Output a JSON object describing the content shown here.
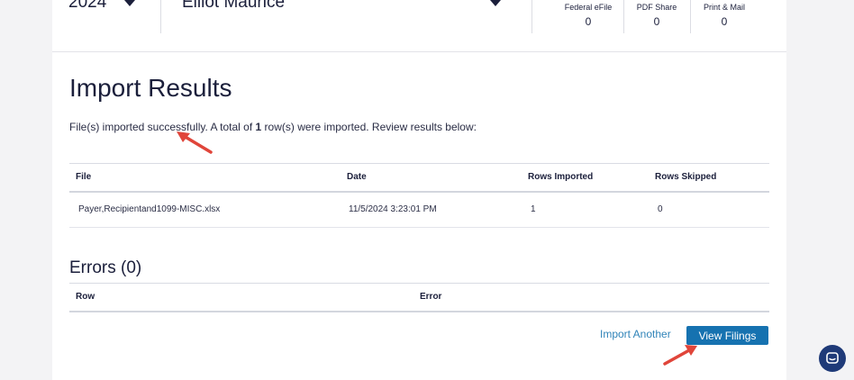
{
  "header": {
    "year": "2024",
    "payer_name": "Elliot Maurice",
    "stats": [
      {
        "label": "Federal eFile",
        "value": "0"
      },
      {
        "label": "PDF Share",
        "value": "0"
      },
      {
        "label": "Print & Mail",
        "value": "0"
      }
    ]
  },
  "import": {
    "title": "Import Results",
    "summary_before": "File(s) imported successfully. A total of ",
    "summary_count": "1",
    "summary_after": " row(s) were imported. Review results below:",
    "columns": [
      "File",
      "Date",
      "Rows Imported",
      "Rows Skipped"
    ],
    "rows": [
      {
        "file": "Payer,Recipientand1099-MISC.xlsx",
        "date": "11/5/2024 3:23:01 PM",
        "rows_imported": "1",
        "rows_skipped": "0"
      }
    ]
  },
  "errors": {
    "title": "Errors (0)",
    "columns": [
      "Row",
      "Error"
    ]
  },
  "actions": {
    "import_another": "Import Another",
    "view_filings": "View Filings"
  },
  "colors": {
    "primary": "#1672b0",
    "link": "#2f83b8",
    "text": "#1b1f3b",
    "annotation_arrow": "#e0453a",
    "chat": "#1f3a78"
  },
  "icons": {
    "year_dropdown": "chevron-down-icon",
    "payer_dropdown": "chevron-down-icon",
    "chat": "chat-icon",
    "annotation": "arrow-icon"
  }
}
